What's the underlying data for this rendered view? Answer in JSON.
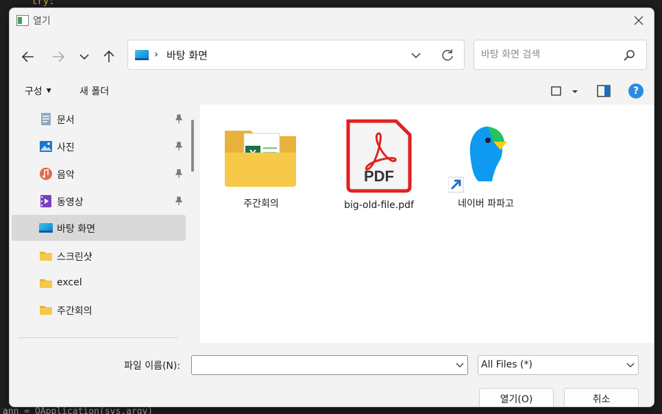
{
  "background": {
    "top_text": "try:",
    "bottom_text": "ann = QApplication(sys.argv)"
  },
  "dialog": {
    "title": "열기"
  },
  "address": {
    "separator": "›",
    "location": "바탕 화면"
  },
  "search": {
    "placeholder": "바탕 화면 검색"
  },
  "toolbar": {
    "organize_label": "구성",
    "organize_caret": "▼",
    "new_folder_label": "새 폴더",
    "help_label": "?"
  },
  "sidebar": {
    "items": [
      {
        "label": "문서",
        "icon": "documents-icon",
        "pinned": true
      },
      {
        "label": "사진",
        "icon": "pictures-icon",
        "pinned": true
      },
      {
        "label": "음악",
        "icon": "music-icon",
        "pinned": true
      },
      {
        "label": "동영상",
        "icon": "videos-icon",
        "pinned": true
      },
      {
        "label": "바탕 화면",
        "icon": "desktop-icon",
        "pinned": false,
        "selected": true
      },
      {
        "label": "스크린샷",
        "icon": "folder-icon",
        "pinned": false
      },
      {
        "label": "excel",
        "icon": "folder-icon",
        "pinned": false
      },
      {
        "label": "주간회의",
        "icon": "folder-icon",
        "pinned": false
      }
    ]
  },
  "files": [
    {
      "name": "주간회의",
      "icon": "excel-folder-icon"
    },
    {
      "name": "big-old-file.pdf",
      "icon": "pdf-icon"
    },
    {
      "name": "네이버 파파고",
      "icon": "papago-shortcut-icon"
    }
  ],
  "footer": {
    "filename_label": "파일 이름(N):",
    "filename_value": "",
    "file_type": "All Files (*)",
    "open_button": "열기(O)",
    "cancel_button": "취소"
  },
  "colors": {
    "accent": "#2a8cde",
    "pdf_red": "#e02020",
    "folder_yellow": "#f7c948",
    "excel_green": "#1e7145"
  }
}
